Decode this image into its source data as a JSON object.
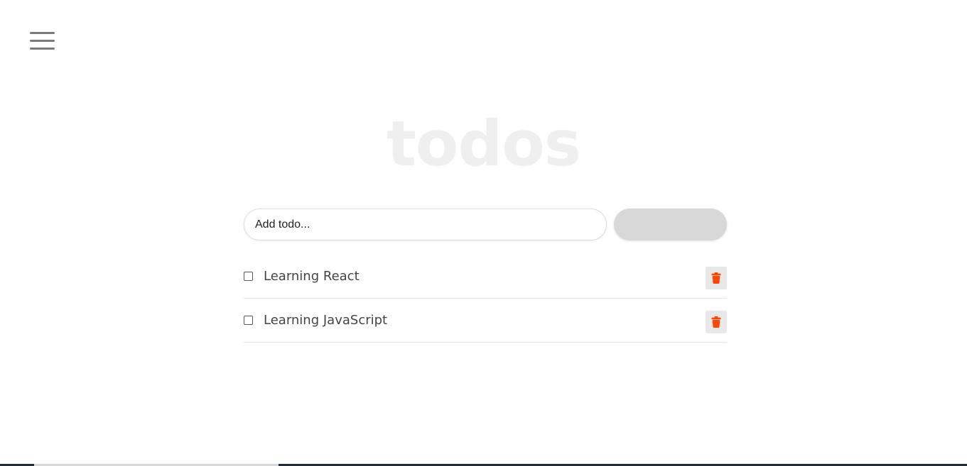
{
  "app": {
    "title": "todos"
  },
  "menu": {
    "icon": "hamburger-menu-icon"
  },
  "add_form": {
    "input_value": "",
    "placeholder": "Add todo...",
    "button_label": ""
  },
  "todos": [
    {
      "label": "Learning React",
      "checked": false,
      "delete_icon": "trash-icon"
    },
    {
      "label": "Learning JavaScript",
      "checked": false,
      "delete_icon": "trash-icon"
    }
  ],
  "colors": {
    "title": "#efefef",
    "delete_icon": "#ff4500",
    "add_button": "#d8d8d8",
    "menu_icon": "#7a7a7a"
  }
}
